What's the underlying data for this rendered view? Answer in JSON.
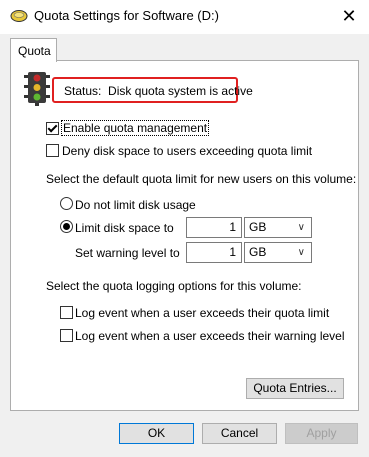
{
  "window": {
    "title": "Quota Settings for Software (D:)",
    "close_label": "✕"
  },
  "tabs": [
    {
      "label": "Quota"
    }
  ],
  "status": {
    "label": "Status:",
    "value": "Disk quota system is active"
  },
  "options": {
    "enable_quota": {
      "label": "Enable quota management",
      "checked": true
    },
    "deny_space": {
      "label": "Deny disk space to users exceeding quota limit",
      "checked": false
    }
  },
  "default_limit": {
    "heading": "Select the default quota limit for new users on this volume:",
    "no_limit_label": "Do not limit disk usage",
    "limit_label": "Limit disk space to",
    "limit_value": "1",
    "limit_unit": "GB",
    "warning_label": "Set warning level to",
    "warning_value": "1",
    "warning_unit": "GB"
  },
  "logging": {
    "heading": "Select the quota logging options for this volume:",
    "log_limit_label": "Log event when a user exceeds their quota limit",
    "log_warning_label": "Log event when a user exceeds their warning level"
  },
  "buttons": {
    "quota_entries": "Quota Entries...",
    "ok": "OK",
    "cancel": "Cancel",
    "apply": "Apply"
  }
}
